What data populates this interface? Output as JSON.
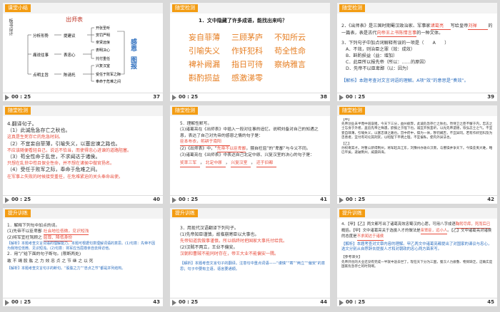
{
  "slides": [
    {
      "tag": "课堂小结",
      "time": "00 : 25",
      "page": "37",
      "side": "板书设计",
      "title": "出师表",
      "b1": "分析形势",
      "b2": "提建议",
      "b3": "痛说往事",
      "b4": "表忠心",
      "b5": "表明决心",
      "b6": "托付重任",
      "b7": "点明主旨",
      "b8": "陈请托",
      "r1": "开张圣听",
      "r2": "赏罚严明",
      "r3": "亲贤远佞",
      "r4": "受任于败军之际",
      "r5": "奉命于危难之间",
      "r6": "兴复汉室",
      "r7": "还于旧都",
      "v1": "感恩",
      "v2": "图报"
    },
    {
      "tag": "随堂检测",
      "time": "00 : 25",
      "page": "38",
      "q": "1．文中隐藏了许多成语，能找出来吗？",
      "idioms": [
        "妄自菲薄",
        "三顾茅庐",
        "不知所云",
        "引喻失义",
        "作奸犯科",
        "苟全性命",
        "裨补阙漏",
        "指日可待",
        "察纳雅言",
        "斟酌损益",
        "感激涕零"
      ]
    },
    {
      "tag": "随堂检测",
      "time": "00 : 25",
      "page": "39",
      "q2": "2．《出师表》是三国时期蜀汉政治家、军事家",
      "a1": "诸葛亮",
      "q2b": "写给皇帝",
      "a2": "刘禅",
      "q2c": "的一篇表，表是古代",
      "a3": "向帝王上书陈情言事",
      "q2d": "的一种文体。",
      "q3": "3．下列句子中加点词解释有误的一项是（　　A　　）",
      "opts": [
        "A．不效，则治臣之罪（效：成效）",
        "B．斟酌损益（益：增加）",
        "C．此臣所以报先帝（所以：……的原因）",
        "D．先帝不以臣卑鄙（以：因为）"
      ],
      "analysis": "【解析】本题考查对文言词语的理解。A项“效”的意思是“奏效”。"
    },
    {
      "tag": "随堂检测",
      "time": "00 : 25",
      "page": "40",
      "q4": "4.翻译句子。",
      "l1": "（1）此诚危急存亡之秋也。",
      "a1": "这真是生死存亡的危急时刻。",
      "l2": "（2）不宜妄自菲薄，引喻失义，以塞忠谏之路也。",
      "a2": "不应该随便看轻自己，说话不恰当，而使得忠心进谏的道路阻塞。",
      "l3": "（3）苟全性命于乱世，不求闻达于诸侯。",
      "a3": "只想在乱世中苟且保全性命，并不想在诸侯中做官扬名。",
      "l4": "（4）受任于败军之际，奉命于危难之间。",
      "a4": "在军事上失败的时候接受重任，在危难紧迫的关头奉命出使。"
    },
    {
      "tag": "随堂检测",
      "time": "00 : 25",
      "page": "41",
      "q5": "5．理解性默写。",
      "p1": "(1)诸葛亮在《出师表》中插入一段对往事的追忆，说明刘备对自己的知遇之恩，表达了自己对先帝的感恩之情的句子是：",
      "a1": "臣本布衣，躬耕于南阳",
      "p2": "(2)《出师表》中，“",
      "a2": "先帝不以臣卑鄙",
      "p2b": "，猥自枉屈”的“卑鄙”与今义不同。",
      "p3": "(3)诸葛亮在《出师表》中表达自己北定中原、兴复汉室的决心的句子是：",
      "a3": "奖率三军",
      "a4": "北定中原",
      "a5": "兴复汉室",
      "a6": "还于旧都"
    },
    {
      "tag": "随堂检测",
      "time": "00 : 25",
      "page": "42",
      "h1": "【甲】",
      "body": "先帝创业未半而中道崩殂，今天下三分，益州疲弊，此诚危急存亡之秋也。然侍卫之臣不懈于内，忠志之士忘身于外者，盖追先帝之殊遇，欲报之于陛下也。诚宜开张圣听，以光先帝遗德，恢弘志士之气，不宜妄自菲薄，引喻失义，以塞忠谏之路也。宫中府中，俱为一体，陟罚臧否，不宜异同。若有作奸犯科及为忠善者，宜付有司论其刑赏，以昭陛下平明之理，不宜偏私，使内外异法也。",
      "h2": "【乙】",
      "body2": "孙权奇其才。时曹公新得荆州，将军起兵江东，刘豫州亦收众汉南，与曹操并争天下。今操芟夷大难，略已平矣，遂破荆州，威震四海。"
    },
    {
      "tag": "提升训练",
      "time": "00 : 25",
      "page": "43",
      "q": "1．解释下列句中加点的词。",
      "l1": "(1)先帝不以臣卑鄙",
      "a1": "社会地位低微，见识短浅",
      "l2": "(2)将军宜枉驾顾之",
      "a2": "屈尊、降低身份",
      "analysis": "【解析】本题考查文言词语的理解能力。本题可根据句意理解词语的意思。(1)句意：先帝不因为我地位低微、见识短浅。(2)句意：将军应当屈尊亲自去拜访他。",
      "q2": "2．用“/”给下面的句子断句。(限断两处)",
      "s": "敢 不 竭 股 肱 之 力 效 忠 贞 之 节 继 之 以 死",
      "analysis2": "【解析】本题考查文言句子的断句。“股肱之力”“忠贞之节”都是并列结构。"
    },
    {
      "tag": "提升训练",
      "time": "00 : 25",
      "page": "44",
      "q": "3．用现代汉语翻译下列句子。",
      "l1": "(1)先帝知臣谨慎，故临崩寄臣以大事也。",
      "a1": "先帝知道我做事谨慎，所以临终时把国家大事托付给我。",
      "l2": "(2)汉贼不两立，王业不偏安。",
      "a2": "汉朝和曹贼不能同时存在，帝王大业不能偏安一隅。",
      "analysis": "【解析】本题考查文言句子的翻译。注意句中重点词语——“谨慎”“寄”“两立”“偏安”的意思；句子中要有主语，语言要通顺。"
    },
    {
      "tag": "提升训练",
      "time": "00 : 25",
      "page": "45",
      "q": "4．【甲】【乙】两文都写出了诸葛亮效忠蜀汉的心愿，可用八字成语",
      "a1": "鞠躬尽瘁，死而后已",
      "q2": "概括。【甲】文中诸葛亮关于选拔人才的做法是",
      "a2": "亲贤臣，远小人",
      "q3": "。【乙】文中诸葛亮对诸侯的态度是",
      "a3": "不求闻达于诸侯",
      "analysis": "【解析】本题考查对文章内容的理解。甲乙两文中诸葛亮都提出了对国家的谏议与忠心，选文分别从自荐辞去提拔人才和对朝政的忠心两方面来写。",
      "ref": "【参考译文】",
      "body": "先帝开创的大业还没有完成一半就中途去世了。现在天下分为三国，蜀汉人力疲惫、物资缺乏，这确实是国家危急存亡的时刻啊。"
    }
  ]
}
